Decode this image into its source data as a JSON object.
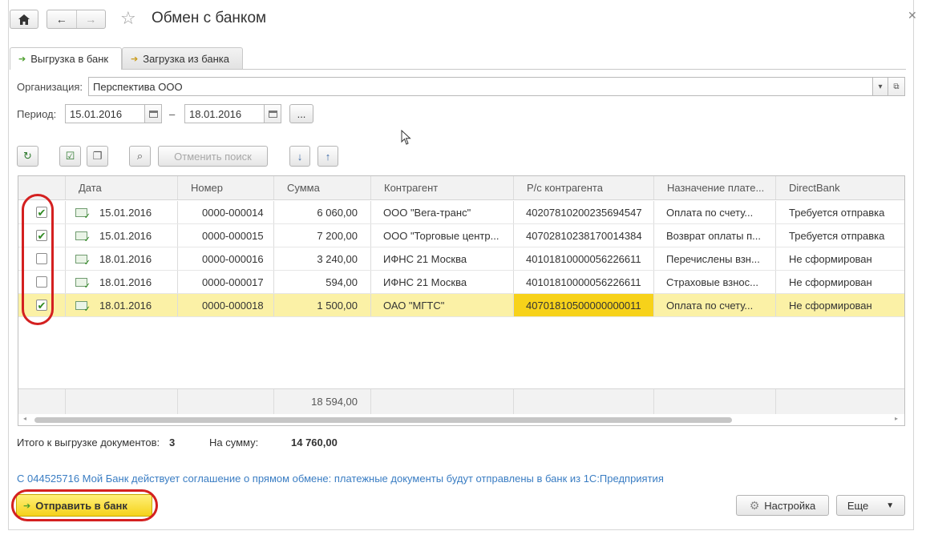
{
  "window": {
    "title": "Обмен с банком"
  },
  "tabs": [
    {
      "label": "Выгрузка в банк",
      "active": true
    },
    {
      "label": "Загрузка из банка",
      "active": false
    }
  ],
  "form": {
    "organization_label": "Организация:",
    "organization_value": "Перспектива ООО",
    "period_label": "Период:",
    "period_from": "15.01.2016",
    "period_dash": "–",
    "period_to": "18.01.2016",
    "period_more": "..."
  },
  "toolbar": {
    "cancel_search_label": "Отменить поиск"
  },
  "table": {
    "columns": [
      "Дата",
      "Номер",
      "Сумма",
      "Контрагент",
      "Р/с контрагента",
      "Назначение плате...",
      "DirectBank"
    ],
    "rows": [
      {
        "checked": true,
        "date": "15.01.2016",
        "number": "0000-000014",
        "sum": "6 060,00",
        "contractor": "ООО \"Вега-транс\"",
        "account": "40207810200235694547",
        "purpose": "Оплата по счету...",
        "status": "Требуется отправка",
        "selected": false
      },
      {
        "checked": true,
        "date": "15.01.2016",
        "number": "0000-000015",
        "sum": "7 200,00",
        "contractor": "ООО \"Торговые центр...",
        "account": "40702810238170014384",
        "purpose": "Возврат оплаты п...",
        "status": "Требуется отправка",
        "selected": false
      },
      {
        "checked": false,
        "date": "18.01.2016",
        "number": "0000-000016",
        "sum": "3 240,00",
        "contractor": "ИФНС 21 Москва",
        "account": "40101810000056226611",
        "purpose": "Перечислены взн...",
        "status": "Не сформирован",
        "selected": false
      },
      {
        "checked": false,
        "date": "18.01.2016",
        "number": "0000-000017",
        "sum": "594,00",
        "contractor": "ИФНС 21 Москва",
        "account": "40101810000056226611",
        "purpose": "Страховые взнос...",
        "status": "Не сформирован",
        "selected": false
      },
      {
        "checked": true,
        "date": "18.01.2016",
        "number": "0000-000018",
        "sum": "1 500,00",
        "contractor": "ОАО \"МГТС\"",
        "account": "40701810500000000011",
        "purpose": "Оплата по счету...",
        "status": "Не сформирован",
        "selected": true
      }
    ],
    "footer_total": "18 594,00"
  },
  "summary": {
    "docs_label": "Итого к выгрузке документов:",
    "docs_count": "3",
    "sum_label": "На сумму:",
    "sum_value": "14 760,00"
  },
  "info_text": "С 044525716 Мой Банк действует соглашение о прямом обмене: платежные документы будут отправлены в банк из 1С:Предприятия",
  "buttons": {
    "send": "Отправить в банк",
    "settings": "Настройка",
    "more": "Еще"
  },
  "colors": {
    "highlight_row": "#fbf1a6",
    "highlight_cell": "#f7d21a",
    "annotation_red": "#d42020",
    "info_blue": "#3a7dc3"
  }
}
